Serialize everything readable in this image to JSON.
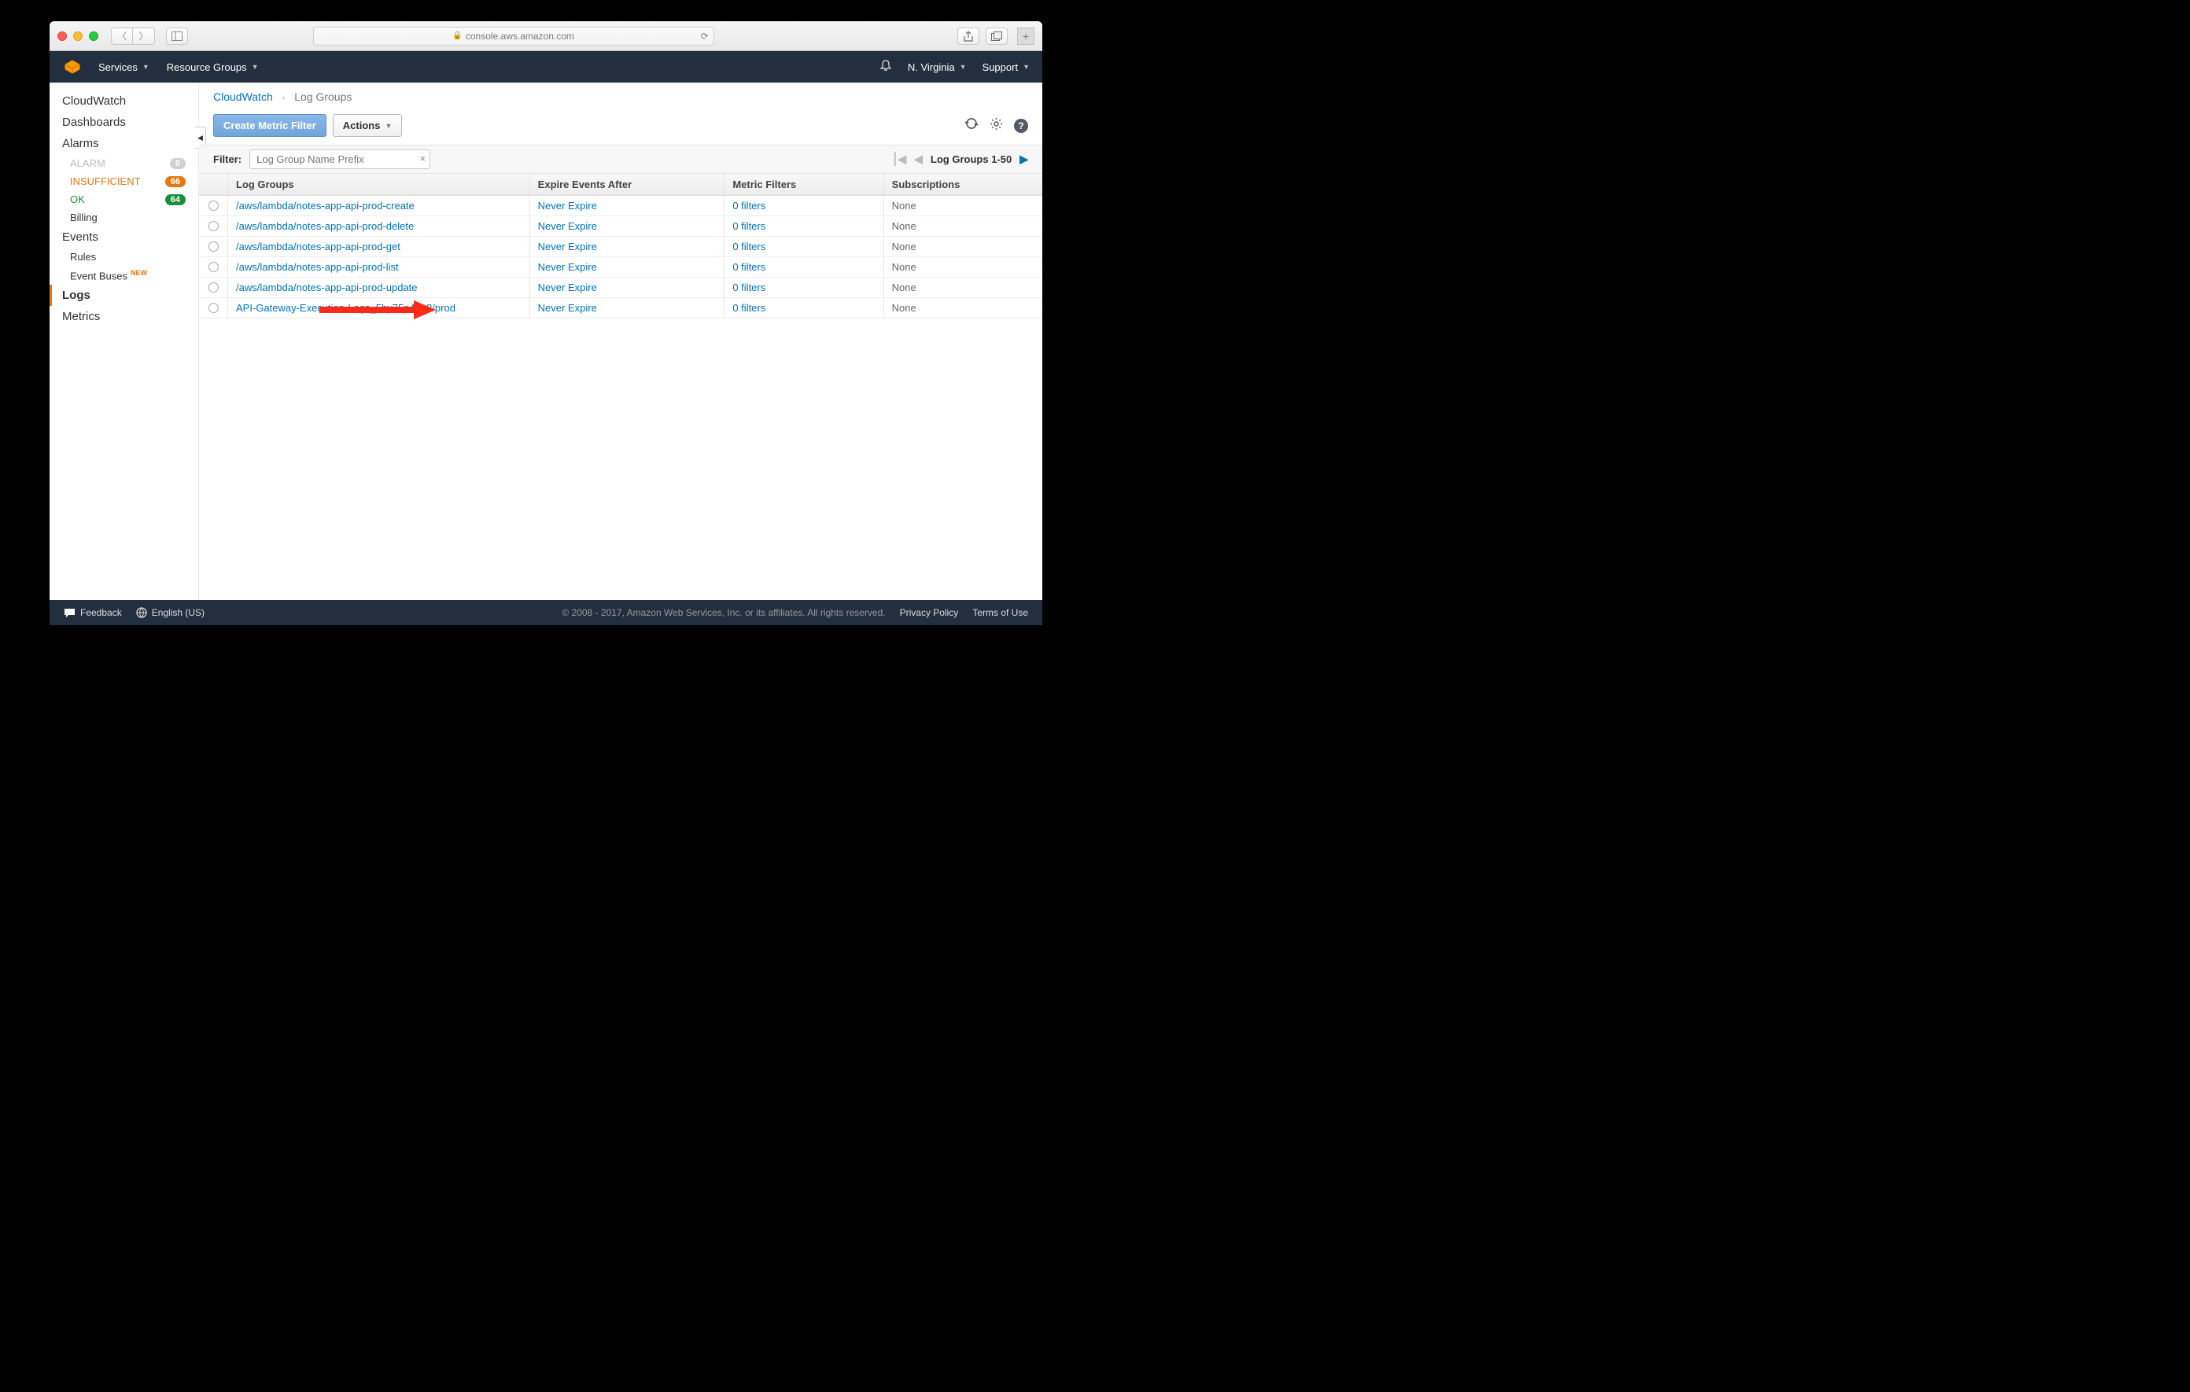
{
  "browser": {
    "url": "console.aws.amazon.com"
  },
  "header": {
    "services": "Services",
    "resource_groups": "Resource Groups",
    "region": "N. Virginia",
    "support": "Support"
  },
  "sidebar": {
    "cloudwatch": "CloudWatch",
    "dashboards": "Dashboards",
    "alarms": "Alarms",
    "alarm_sub": [
      {
        "label": "ALARM",
        "badge": "0",
        "cls": "alarm",
        "bcls": "grey"
      },
      {
        "label": "INSUFFICIENT",
        "badge": "66",
        "cls": "insuf",
        "bcls": "orange"
      },
      {
        "label": "OK",
        "badge": "64",
        "cls": "ok",
        "bcls": "green"
      }
    ],
    "billing": "Billing",
    "events": "Events",
    "rules": "Rules",
    "event_buses": "Event Buses",
    "new_tag": "NEW",
    "logs": "Logs",
    "metrics": "Metrics"
  },
  "breadcrumb": {
    "root": "CloudWatch",
    "current": "Log Groups"
  },
  "toolbar": {
    "create": "Create Metric Filter",
    "actions": "Actions"
  },
  "filter": {
    "label": "Filter:",
    "placeholder": "Log Group Name Prefix"
  },
  "pager": {
    "label": "Log Groups 1-50"
  },
  "table": {
    "headers": {
      "name": "Log Groups",
      "expire": "Expire Events After",
      "filters": "Metric Filters",
      "subs": "Subscriptions"
    },
    "rows": [
      {
        "name": "/aws/lambda/notes-app-api-prod-create",
        "expire": "Never Expire",
        "filters": "0 filters",
        "subs": "None"
      },
      {
        "name": "/aws/lambda/notes-app-api-prod-delete",
        "expire": "Never Expire",
        "filters": "0 filters",
        "subs": "None"
      },
      {
        "name": "/aws/lambda/notes-app-api-prod-get",
        "expire": "Never Expire",
        "filters": "0 filters",
        "subs": "None"
      },
      {
        "name": "/aws/lambda/notes-app-api-prod-list",
        "expire": "Never Expire",
        "filters": "0 filters",
        "subs": "None"
      },
      {
        "name": "/aws/lambda/notes-app-api-prod-update",
        "expire": "Never Expire",
        "filters": "0 filters",
        "subs": "None"
      },
      {
        "name": "API-Gateway-Execution-Logs_5by75p4gn3/prod",
        "expire": "Never Expire",
        "filters": "0 filters",
        "subs": "None"
      }
    ]
  },
  "footer": {
    "feedback": "Feedback",
    "language": "English (US)",
    "copyright": "© 2008 - 2017, Amazon Web Services, Inc. or its affiliates. All rights reserved.",
    "privacy": "Privacy Policy",
    "terms": "Terms of Use"
  }
}
